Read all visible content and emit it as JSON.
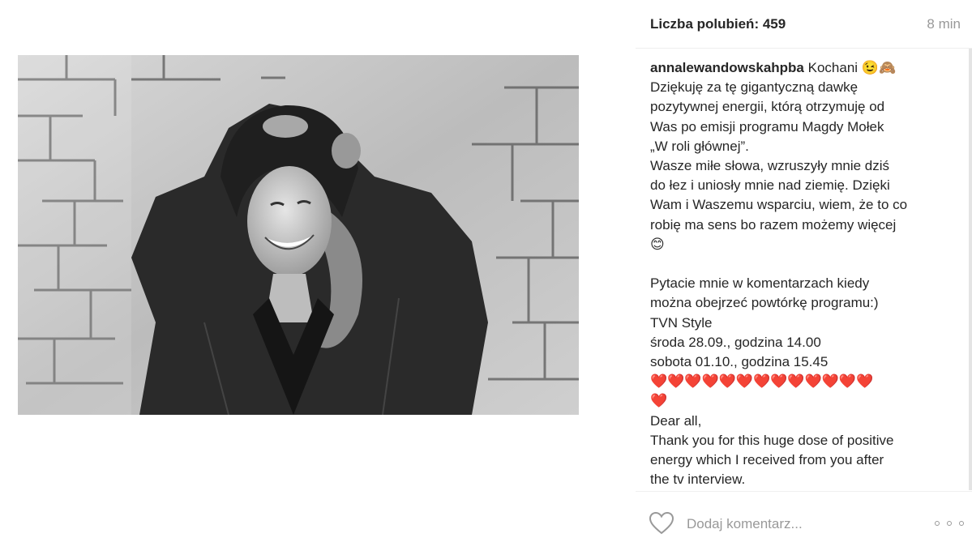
{
  "post": {
    "likes_label": "Liczba polubień: 459",
    "time_ago": "8 min",
    "username": "annalewandowskahpba",
    "caption_lines": [
      " Kochani 😉🙈",
      "Dziękuję za tę gigantyczną dawkę",
      "pozytywnej energii, którą otrzymuję od",
      "Was po emisji programu Magdy Mołek",
      "„W roli głównej”.",
      "Wasze miłe słowa, wzruszyły mnie dziś",
      "do łez i uniosły mnie nad ziemię. Dzięki",
      "Wam i Waszemu wsparciu, wiem, że to co",
      "robię ma sens bo razem możemy więcej",
      "😊",
      "",
      "Pytacie mnie w komentarzach kiedy",
      "można obejrzeć powtórkę programu:)",
      "TVN Style",
      "środa 28.09., godzina 14.00",
      "sobota 01.10., godzina 15.45",
      "❤️❤️❤️❤️❤️❤️❤️❤️❤️❤️❤️❤️❤️",
      "❤️",
      "Dear all,",
      "Thank you for this huge dose of positive",
      "energy which I received from you after",
      "the tv interview."
    ]
  },
  "comment": {
    "placeholder": "Dodaj komentarz..."
  },
  "icons": {
    "like": "heart-outline-icon",
    "more": "more-options-icon"
  },
  "colors": {
    "text": "#262626",
    "muted": "#999999",
    "heart": "#e0192d"
  }
}
